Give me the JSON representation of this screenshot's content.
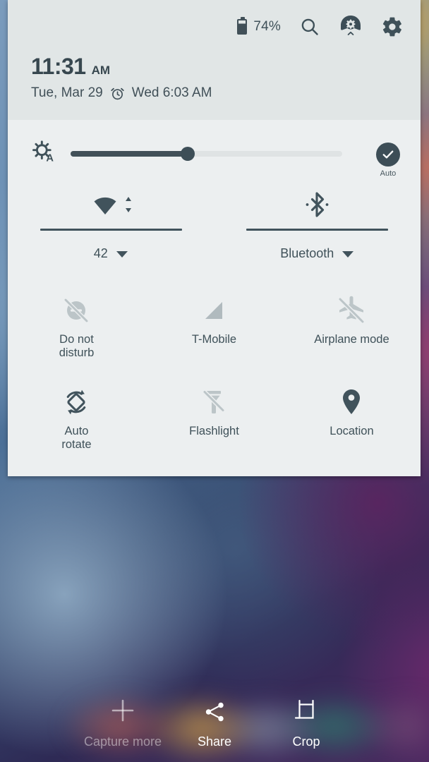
{
  "panel": {
    "header": {
      "battery": {
        "percent_label": "74%",
        "level": 74,
        "icon": "battery-icon"
      },
      "search_icon": "search-icon",
      "quick_settings_edit_icon": "quick-settings-gear-badge-icon",
      "settings_icon": "gear-icon",
      "clock": {
        "time": "11:31",
        "ampm": "AM"
      },
      "date": "Tue, Mar 29",
      "alarm_icon": "alarm-clock-icon",
      "alarm_time": "Wed 6:03 AM"
    },
    "brightness": {
      "icon": "auto-brightness-icon",
      "value_percent": 43,
      "auto_label": "Auto",
      "auto_enabled": true,
      "auto_icon": "check-circle-icon"
    },
    "connectivity": [
      {
        "name": "wifi",
        "icon": "wifi-icon",
        "activity_icon": "data-activity-arrows-icon",
        "label": "42",
        "chevron": "chevron-down-icon",
        "enabled": true
      },
      {
        "name": "bluetooth",
        "icon": "bluetooth-icon",
        "label": "Bluetooth",
        "chevron": "chevron-down-icon",
        "enabled": true
      }
    ],
    "tiles": [
      {
        "label": "Do not\ndisturb",
        "icon": "do-not-disturb-icon",
        "state": "off"
      },
      {
        "label": "T-Mobile",
        "icon": "mobile-signal-icon",
        "state": "off"
      },
      {
        "label": "Airplane mode",
        "icon": "airplane-mode-off-icon",
        "state": "off"
      },
      {
        "label": "Auto\nrotate",
        "icon": "auto-rotate-icon",
        "state": "on"
      },
      {
        "label": "Flashlight",
        "icon": "flashlight-off-icon",
        "state": "off"
      },
      {
        "label": "Location",
        "icon": "location-pin-icon",
        "state": "on"
      }
    ]
  },
  "screenshot_toolbar": [
    {
      "label": "Capture more",
      "icon": "plus-icon",
      "enabled": false
    },
    {
      "label": "Share",
      "icon": "share-icon",
      "enabled": true
    },
    {
      "label": "Crop",
      "icon": "crop-icon",
      "enabled": true
    }
  ],
  "colors": {
    "panel_body": "#eceff0",
    "panel_header": "#e1e6e6",
    "accent_dark": "#3f5159",
    "icon_active": "#41535c",
    "icon_inactive": "#b6bfc2",
    "slider_track": "#dfe3e4"
  }
}
